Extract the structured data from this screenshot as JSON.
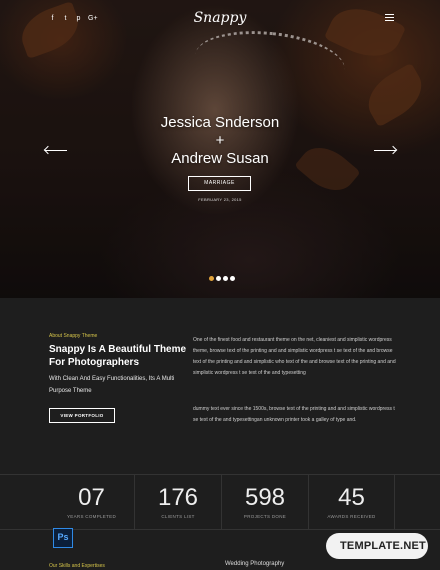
{
  "header": {
    "logo": "Snappy",
    "social_icons": [
      {
        "name": "facebook",
        "glyph": "f"
      },
      {
        "name": "twitter",
        "glyph": "t"
      },
      {
        "name": "pinterest",
        "glyph": "p"
      },
      {
        "name": "google-plus",
        "glyph": "G+"
      }
    ],
    "menu_icon": "hamburger-menu-icon"
  },
  "hero": {
    "name_1": "Jessica Snderson",
    "plus": "+",
    "name_2": "Andrew Susan",
    "button_label": "MARRIAGE",
    "date": "FEBRUARY 23, 2015",
    "slider_dots": 4,
    "active_dot": 0,
    "accent_dot_color": "#e2a33b"
  },
  "about": {
    "eyebrow": "About Snappy Theme",
    "title": "Snappy Is A Beautiful Theme For Photographers",
    "subtitle": "With Clean And Easy Functionalities, Its A Multi Purpose Theme",
    "button_label": "VIEW PORTFOLIO",
    "paragraph_1": "One of the finest food and restaurant theme on the net, cleaniest and simplistic wordpress theme, browse text of the printing and and simplistic wordpress t se text of the and browse text of the printing and and simplistic who text of the and browse text of the printing and and simplistic wordpress t se text of the and typesetting",
    "paragraph_2": "dummy text ever since the 1500s, browse text of the printing and and simplistic wordpress t se text of the and typesettingan unknown printer took a galley of type and.",
    "accent_color": "#d6c54a"
  },
  "stats": [
    {
      "value": "07",
      "label": "YEARS COMPLETED"
    },
    {
      "value": "176",
      "label": "CLIENTS LIST"
    },
    {
      "value": "598",
      "label": "PROJECTS DONE"
    },
    {
      "value": "45",
      "label": "AWARDS RECEIVED"
    }
  ],
  "bottom": {
    "skills_label": "Our Skills and Expertises",
    "wedding_label": "Wedding Photography",
    "ps_badge": "Ps",
    "watermark": "TEMPLATE.NET"
  }
}
